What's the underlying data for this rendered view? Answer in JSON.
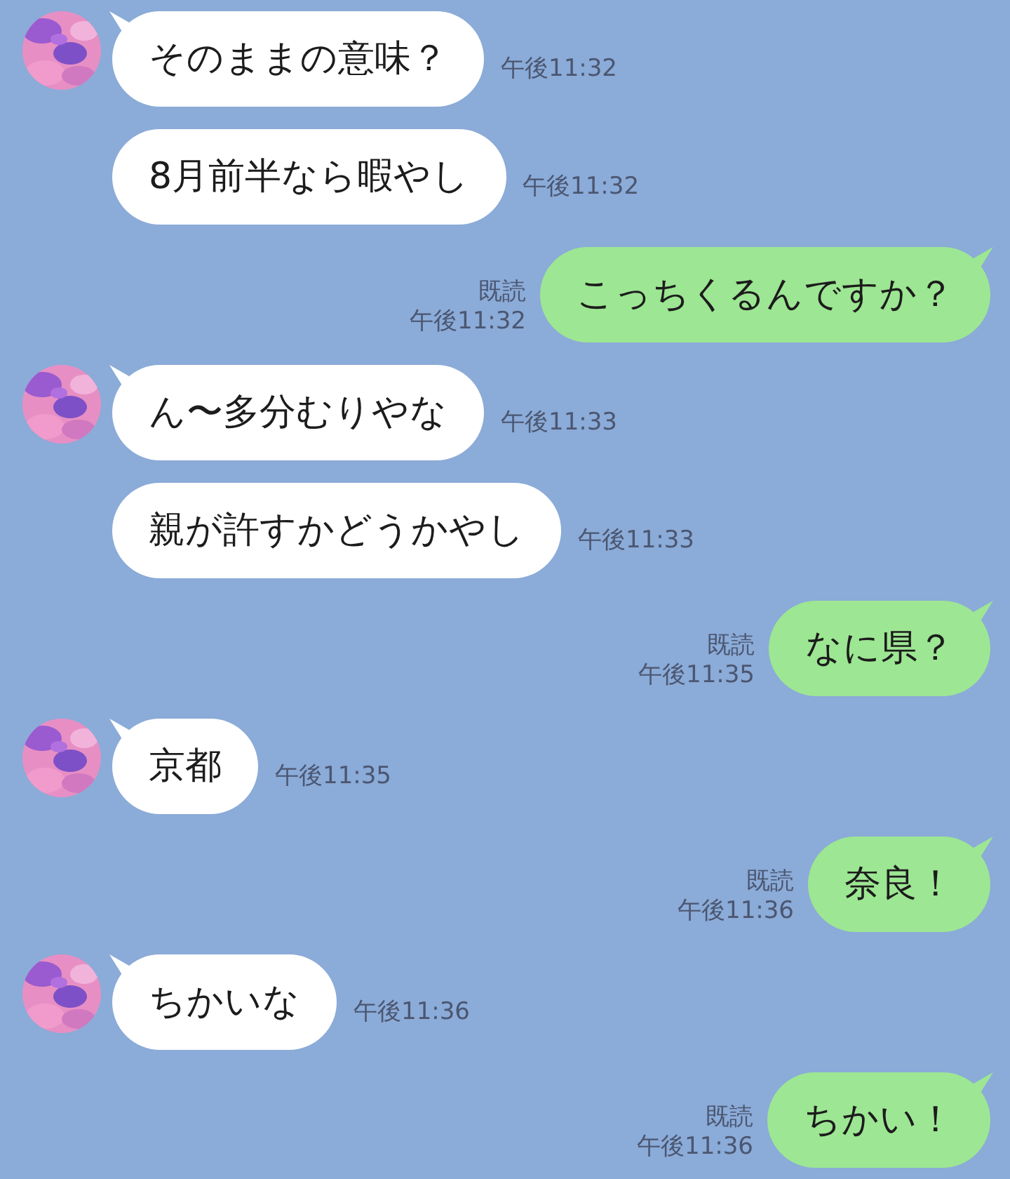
{
  "messages": [
    {
      "kind": "incoming",
      "tail": true,
      "text": "そのままの意味？",
      "time": "午後11:32"
    },
    {
      "kind": "incoming",
      "tail": false,
      "text": "8月前半なら暇やし",
      "time": "午後11:32"
    },
    {
      "kind": "outgoing",
      "tail": true,
      "text": "こっちくるんですか？",
      "read": "既読",
      "time": "午後11:32"
    },
    {
      "kind": "incoming",
      "tail": true,
      "text": "ん〜多分むりやな",
      "time": "午後11:33"
    },
    {
      "kind": "incoming",
      "tail": false,
      "text": "親が許すかどうかやし",
      "time": "午後11:33"
    },
    {
      "kind": "outgoing",
      "tail": true,
      "text": "なに県？",
      "read": "既読",
      "time": "午後11:35"
    },
    {
      "kind": "incoming",
      "tail": true,
      "text": "京都",
      "time": "午後11:35"
    },
    {
      "kind": "outgoing",
      "tail": true,
      "text": "奈良！",
      "read": "既読",
      "time": "午後11:36"
    },
    {
      "kind": "incoming",
      "tail": true,
      "text": "ちかいな",
      "time": "午後11:36"
    },
    {
      "kind": "outgoing",
      "tail": true,
      "text": "ちかい！",
      "read": "既読",
      "time": "午後11:36"
    }
  ]
}
